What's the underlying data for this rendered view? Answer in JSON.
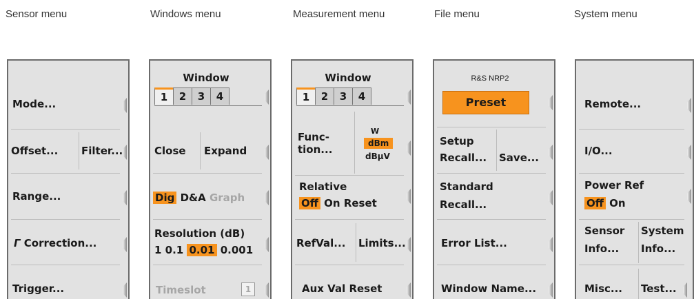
{
  "captions": {
    "sensor": "Sensor menu",
    "windows": "Windows menu",
    "measurement": "Measurement menu",
    "file": "File menu",
    "system": "System menu"
  },
  "sensor_menu": {
    "mode": "Mode...",
    "offset": "Offset...",
    "filter": "Filter...",
    "range": "Range...",
    "correction_symbol": "Γ",
    "correction": "Correction...",
    "trigger": "Trigger..."
  },
  "windows_menu": {
    "title": "Window",
    "tabs": [
      "1",
      "2",
      "3",
      "4"
    ],
    "close": "Close",
    "expand": "Expand",
    "dig": "Dig",
    "da": "D&A",
    "graph": "Graph",
    "resolution_label": "Resolution (dB)",
    "res_values": [
      "1",
      "0.1",
      "0.01",
      "0.001"
    ],
    "timeslot": "Timeslot",
    "timeslot_value": "1"
  },
  "measurement_menu": {
    "title": "Window",
    "tabs": [
      "1",
      "2",
      "3",
      "4"
    ],
    "function_line1": "Func-",
    "function_line2": "tion...",
    "unit_w": "W",
    "unit_dbm": "dBm",
    "unit_dbuv": "dBµV",
    "relative": "Relative",
    "off": "Off",
    "on": "On",
    "reset": "Reset",
    "refval": "RefVal...",
    "limits": "Limits...",
    "aux_val_reset": "Aux Val Reset"
  },
  "file_menu": {
    "device": "R&S NRP2",
    "preset": "Preset",
    "setup_line1": "Setup",
    "setup_line2": "Recall...",
    "save": "Save...",
    "standard_line1": "Standard",
    "standard_line2": "Recall...",
    "error_list": "Error List...",
    "window_name": "Window Name..."
  },
  "system_menu": {
    "remote": "Remote...",
    "io": "I/O...",
    "power_ref": "Power Ref",
    "off": "Off",
    "on": "On",
    "sensor_info_line1": "Sensor",
    "sensor_info_line2": "Info...",
    "system_info_line1": "System",
    "system_info_line2": "Info...",
    "misc": "Misc...",
    "test": "Test..."
  },
  "colors": {
    "highlight": "#f7931e",
    "panel": "#e2e2e2",
    "border": "#6b6b6b"
  },
  "icons": {
    "softkey": "softkey-arrow-icon"
  }
}
